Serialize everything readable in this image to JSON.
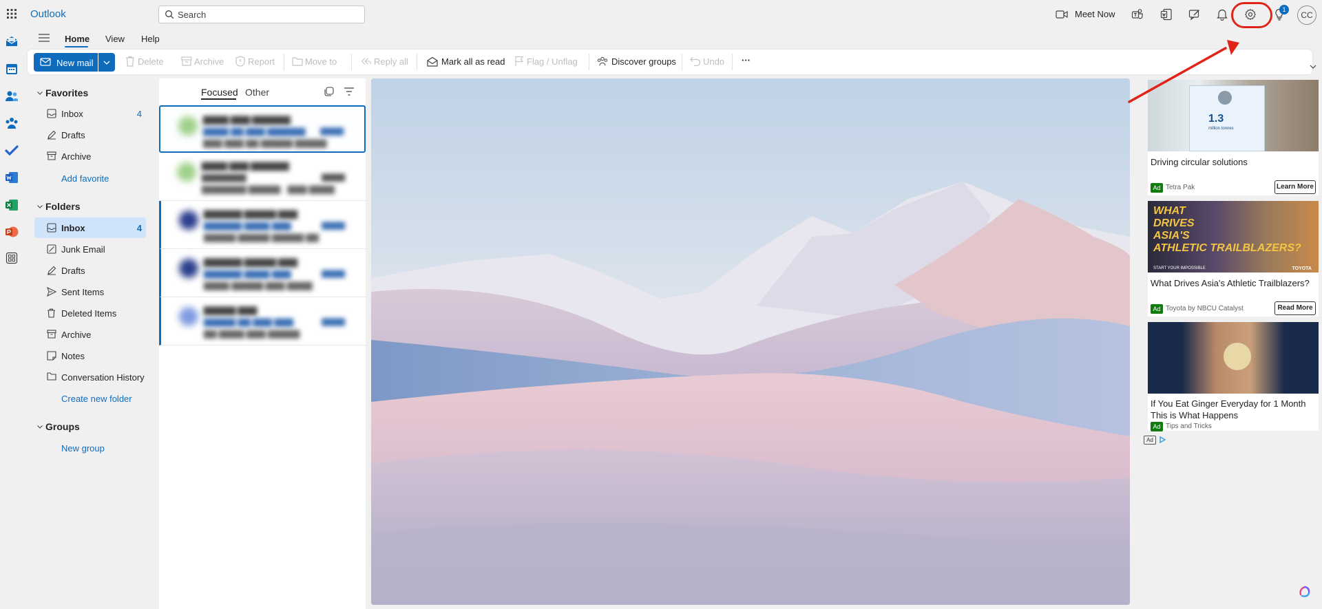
{
  "app": {
    "title": "Outlook",
    "user_initials": "CC"
  },
  "search": {
    "placeholder": "Search"
  },
  "topbar": {
    "meet_now_label": "Meet Now",
    "tips_badge_count": "1"
  },
  "menu_tabs": [
    {
      "label": "Home"
    },
    {
      "label": "View"
    },
    {
      "label": "Help"
    }
  ],
  "commands": {
    "new_mail": "New mail",
    "delete": "Delete",
    "archive": "Archive",
    "report": "Report",
    "move_to": "Move to",
    "reply_all": "Reply all",
    "mark_all_read": "Mark all as read",
    "flag_unflag": "Flag / Unflag",
    "discover_groups": "Discover groups",
    "undo": "Undo",
    "more": "···"
  },
  "favorites": {
    "header": "Favorites",
    "items": [
      {
        "label": "Inbox",
        "count": "4"
      },
      {
        "label": "Drafts",
        "count": ""
      },
      {
        "label": "Archive",
        "count": ""
      }
    ],
    "add_link": "Add favorite"
  },
  "folders": {
    "header": "Folders",
    "items": [
      {
        "label": "Inbox",
        "count": "4"
      },
      {
        "label": "Junk Email",
        "count": ""
      },
      {
        "label": "Drafts",
        "count": ""
      },
      {
        "label": "Sent Items",
        "count": ""
      },
      {
        "label": "Deleted Items",
        "count": ""
      },
      {
        "label": "Archive",
        "count": ""
      },
      {
        "label": "Notes",
        "count": ""
      },
      {
        "label": "Conversation History",
        "count": ""
      }
    ],
    "create_link": "Create new folder"
  },
  "groups": {
    "header": "Groups",
    "new_link": "New group"
  },
  "message_list": {
    "tabs": [
      {
        "label": "Focused"
      },
      {
        "label": "Other"
      }
    ]
  },
  "ads": [
    {
      "title": "Driving circular solutions",
      "badge": "Ad",
      "sponsor": "Tetra Pak",
      "button": "Learn More",
      "image_text": [
        "1.3",
        "million tonnes"
      ]
    },
    {
      "title": "What Drives Asia's Athletic Trailblazers?",
      "badge": "Ad",
      "sponsor": "Toyota by NBCU Catalyst",
      "button": "Read More",
      "image_text": [
        "WHAT",
        "DRIVES",
        "ASIA'S",
        "ATHLETIC",
        "TRAILBLAZERS?",
        "START YOUR IMPOSSIBLE",
        "TOYOTA"
      ]
    },
    {
      "title": "If You Eat Ginger Everyday for 1 Month This is What Happens",
      "badge": "Ad",
      "sponsor": "Tips and Tricks",
      "button": ""
    }
  ],
  "ad_choices_label": "Ad",
  "colors": {
    "accent": "#0f6cbd",
    "annotation": "#e02418",
    "selected_bg": "#cfe4fa"
  }
}
